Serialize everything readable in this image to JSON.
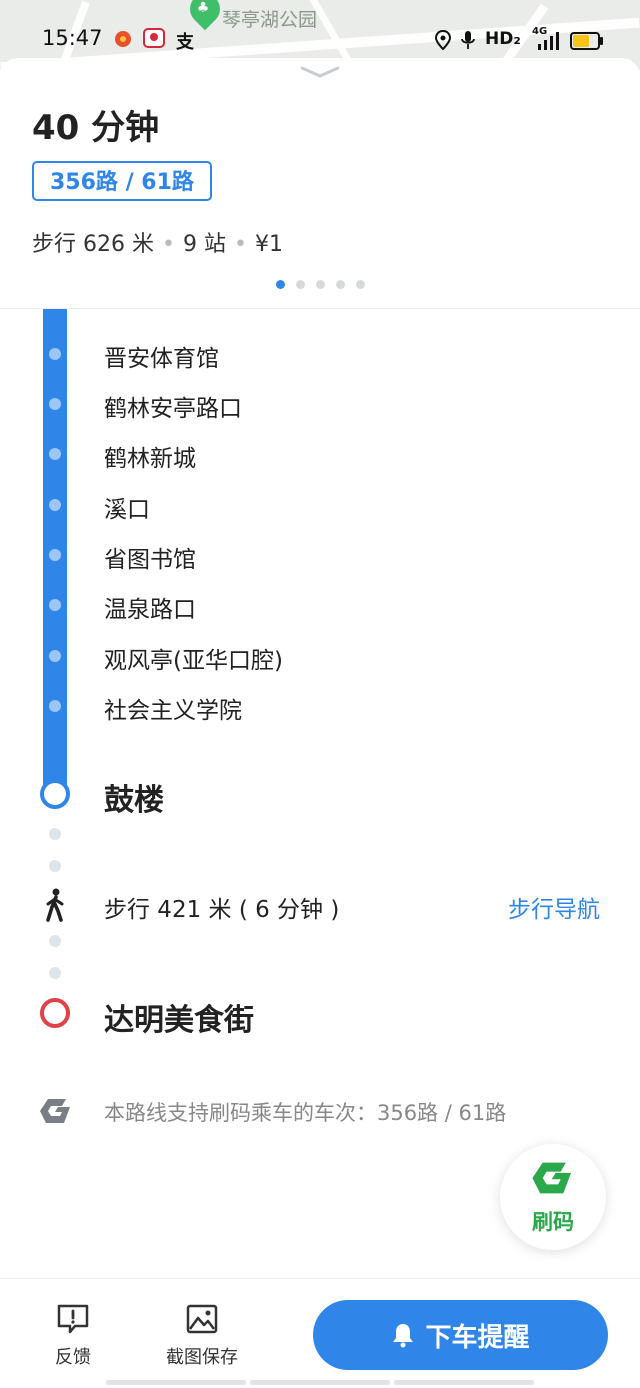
{
  "status_bar": {
    "time": "15:47",
    "network": "HD₂",
    "signal": "4G"
  },
  "map": {
    "poi_label": "琴亭湖公园"
  },
  "route": {
    "duration": "40 分钟",
    "lines": "356路 / 61路",
    "walk": "步行 626 米",
    "stops_count": "9 站",
    "fare": "¥1"
  },
  "stops": [
    "晋安体育馆",
    "鹤林安亭路口",
    "鹤林新城",
    "溪口",
    "省图书馆",
    "温泉路口",
    "观风亭(亚华口腔)",
    "社会主义学院"
  ],
  "alight_stop": "鼓楼",
  "walk_segment": {
    "text": "步行 421 米 ( 6 分钟 )",
    "nav_label": "步行导航"
  },
  "destination": "达明美食街",
  "support_note": "本路线支持刷码乘车的车次：356路 / 61路",
  "scan_button": {
    "label": "刷码"
  },
  "bottom": {
    "feedback": "反馈",
    "screenshot_save": "截图保存",
    "remind": "下车提醒"
  },
  "colors": {
    "accent": "#2f86e8",
    "destination": "#e0424a",
    "scan_green": "#2aa84a"
  }
}
